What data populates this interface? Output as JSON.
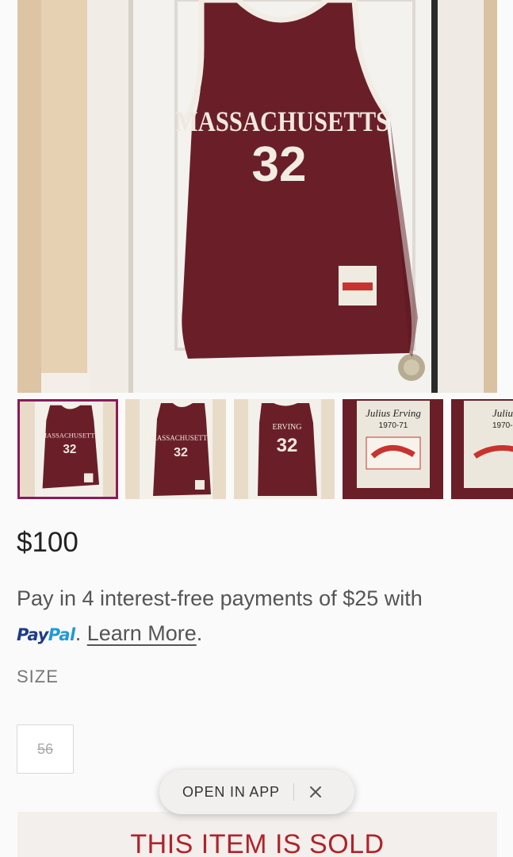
{
  "product_images": {
    "jersey_school_text": "MASSACHUSETTS",
    "jersey_number": "32",
    "tag_name": "Julius Erving",
    "tag_years": "1970-71",
    "back_name": "ERVING",
    "selected_index": 0
  },
  "price": "$100",
  "paypal": {
    "text": "Pay in 4 interest-free payments of $25 with",
    "logo_pay": "Pay",
    "logo_pal": "Pal",
    "period": ".",
    "learn_more": "Learn More",
    "trailing": "."
  },
  "size": {
    "label": "SIZE",
    "option": "56"
  },
  "app_banner": {
    "open_label": "OPEN IN APP"
  },
  "sold_banner": {
    "text": "THIS ITEM IS SOLD"
  },
  "colors": {
    "jersey": "#6a1f28",
    "selected_border": "#8b1a5a",
    "sold_text": "#b0232a",
    "paypal_dark": "#1d3c87",
    "paypal_light": "#1f9ad6"
  }
}
